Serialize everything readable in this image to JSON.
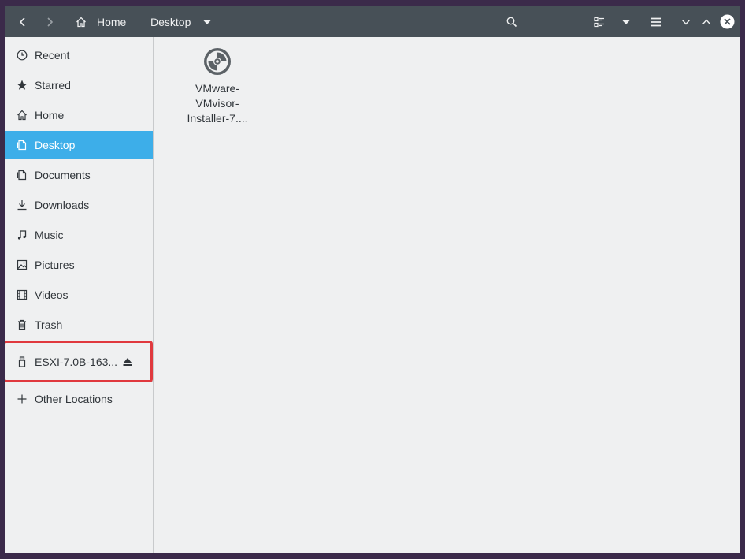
{
  "header": {
    "breadcrumb_home": "Home",
    "breadcrumb_current": "Desktop"
  },
  "sidebar": {
    "items": [
      {
        "label": "Recent",
        "icon": "clock-icon"
      },
      {
        "label": "Starred",
        "icon": "star-icon"
      },
      {
        "label": "Home",
        "icon": "home-icon"
      },
      {
        "label": "Desktop",
        "icon": "desktop-icon",
        "active": true
      },
      {
        "label": "Documents",
        "icon": "documents-icon"
      },
      {
        "label": "Downloads",
        "icon": "downloads-icon"
      },
      {
        "label": "Music",
        "icon": "music-icon"
      },
      {
        "label": "Pictures",
        "icon": "pictures-icon"
      },
      {
        "label": "Videos",
        "icon": "videos-icon"
      },
      {
        "label": "Trash",
        "icon": "trash-icon"
      }
    ],
    "device": {
      "label": "ESXI-7.0B-163...",
      "icon": "usb-drive-icon",
      "action_icon": "eject-icon"
    },
    "other_locations": {
      "label": "Other Locations",
      "icon": "plus-icon"
    }
  },
  "content": {
    "files": [
      {
        "name_lines": [
          "VMware-",
          "VMvisor-",
          "Installer-7...."
        ],
        "icon": "disc-image-icon"
      }
    ]
  },
  "colors": {
    "header_bg": "#475057",
    "accent": "#3daee9",
    "highlight_border": "#e0393e"
  }
}
